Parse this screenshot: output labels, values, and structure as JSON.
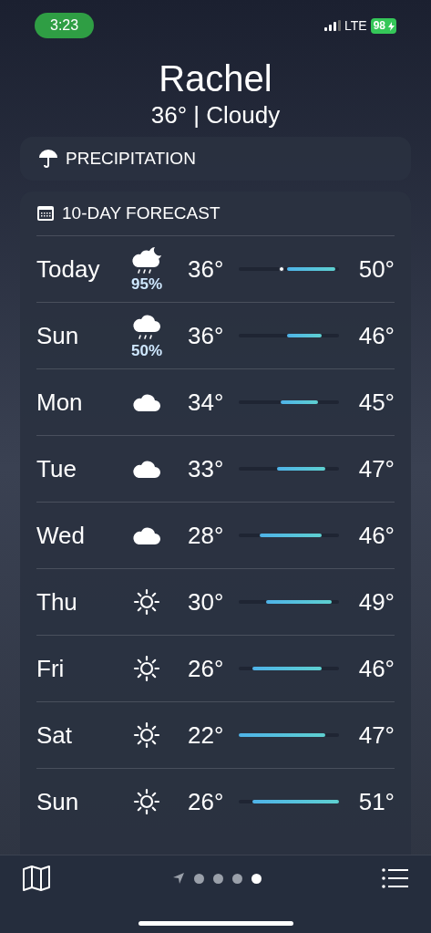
{
  "status_bar": {
    "time": "3:23",
    "network": "LTE",
    "battery": "98"
  },
  "location": {
    "name": "Rachel",
    "summary": "36° | Cloudy"
  },
  "precipitation": {
    "title": "PRECIPITATION"
  },
  "forecast": {
    "title": "10-DAY FORECAST",
    "days": [
      {
        "day": "Today",
        "kind": "rain_night",
        "chance": "95%",
        "low": "36°",
        "high": "50°",
        "current_marker": true
      },
      {
        "day": "Sun",
        "kind": "rain",
        "chance": "50%",
        "low": "36°",
        "high": "46°",
        "current_marker": false
      },
      {
        "day": "Mon",
        "kind": "cloud",
        "low": "34°",
        "high": "45°",
        "current_marker": false
      },
      {
        "day": "Tue",
        "kind": "cloud",
        "low": "33°",
        "high": "47°",
        "current_marker": false
      },
      {
        "day": "Wed",
        "kind": "cloud",
        "low": "28°",
        "high": "46°",
        "current_marker": false
      },
      {
        "day": "Thu",
        "kind": "sun",
        "low": "30°",
        "high": "49°",
        "current_marker": false
      },
      {
        "day": "Fri",
        "kind": "sun",
        "low": "26°",
        "high": "46°",
        "current_marker": false
      },
      {
        "day": "Sat",
        "kind": "sun",
        "low": "22°",
        "high": "47°",
        "current_marker": false
      },
      {
        "day": "Sun",
        "kind": "sun",
        "low": "26°",
        "high": "51°",
        "current_marker": false
      }
    ]
  },
  "pages": [
    {
      "kind": "location",
      "selected": false
    },
    {
      "kind": "dot",
      "selected": false
    },
    {
      "kind": "dot",
      "selected": false
    },
    {
      "kind": "dot",
      "selected": false
    },
    {
      "kind": "dot",
      "selected": true
    }
  ]
}
